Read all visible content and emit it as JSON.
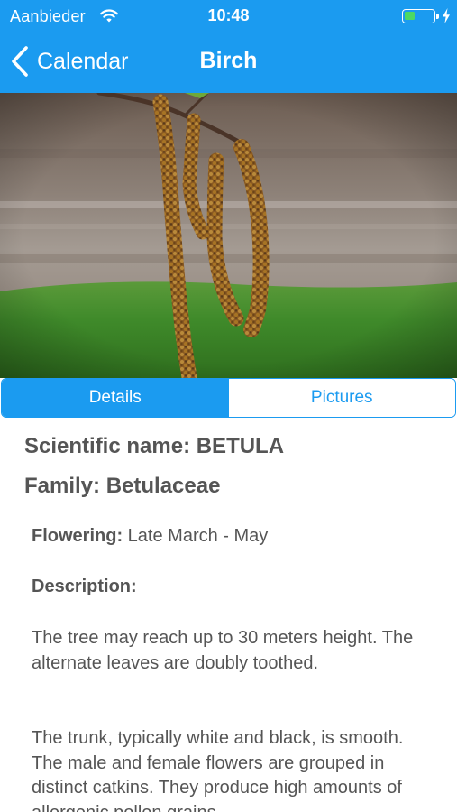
{
  "status_bar": {
    "carrier": "Aanbieder",
    "time": "10:48",
    "battery_level": 0.35,
    "battery_color": "#4cd964"
  },
  "nav": {
    "back_label": "Calendar",
    "title": "Birch",
    "accent_color": "#1b9bf0"
  },
  "hero_image": {
    "subject": "birch catkins hanging from a branch"
  },
  "tabs": [
    {
      "label": "Details",
      "selected": true
    },
    {
      "label": "Pictures",
      "selected": false
    }
  ],
  "details": {
    "scientific_name": "Scientific name: BETULA",
    "family": "Family: Betulaceae",
    "flowering_label": "Flowering:",
    "flowering_value": "Late March - May",
    "description_label": "Description:",
    "paragraphs": [
      "The tree may reach up to 30 meters height. The alternate leaves are doubly toothed.",
      "The trunk, typically white and black, is smooth. The male and female flowers are grouped in distinct catkins. They produce high amounts of allergenic pollen grains."
    ]
  }
}
